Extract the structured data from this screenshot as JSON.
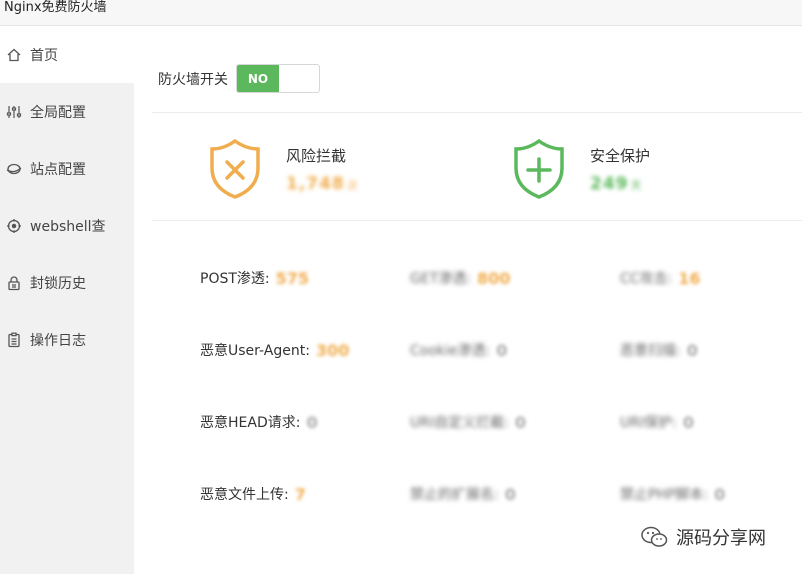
{
  "app": {
    "title": "Nginx免费防火墙"
  },
  "sidebar": {
    "items": [
      {
        "label": "首页",
        "icon": "home-icon"
      },
      {
        "label": "全局配置",
        "icon": "sliders-icon"
      },
      {
        "label": "站点配置",
        "icon": "globe-icon"
      },
      {
        "label": "webshell查",
        "icon": "target-icon"
      },
      {
        "label": "封锁历史",
        "icon": "lock-icon"
      },
      {
        "label": "操作日志",
        "icon": "clipboard-icon"
      }
    ]
  },
  "switch": {
    "label": "防火墙开关",
    "state": "NO"
  },
  "stats": {
    "risk": {
      "title": "风险拦截",
      "value": "1,748",
      "unit": "次",
      "color": "#f0ad4e"
    },
    "safe": {
      "title": "安全保护",
      "value": "249",
      "unit": "天",
      "color": "#5cb85c"
    }
  },
  "grid": [
    [
      {
        "label": "POST渗透:",
        "value": "575"
      },
      {
        "label": "GET渗透:",
        "value": "800"
      },
      {
        "label": "CC攻击:",
        "value": "16"
      }
    ],
    [
      {
        "label": "恶意User-Agent:",
        "value": "300"
      },
      {
        "label": "Cookie渗透:",
        "value": "0"
      },
      {
        "label": "恶意扫描:",
        "value": "0"
      }
    ],
    [
      {
        "label": "恶意HEAD请求:",
        "value": "0"
      },
      {
        "label": "URI自定义拦截:",
        "value": "0"
      },
      {
        "label": "URI保护:",
        "value": "0"
      }
    ],
    [
      {
        "label": "恶意文件上传:",
        "value": "7"
      },
      {
        "label": "禁止的扩展名:",
        "value": "0"
      },
      {
        "label": "禁止PHP脚本:",
        "value": "0"
      }
    ]
  ],
  "watermark": {
    "text": "源码分享网"
  }
}
